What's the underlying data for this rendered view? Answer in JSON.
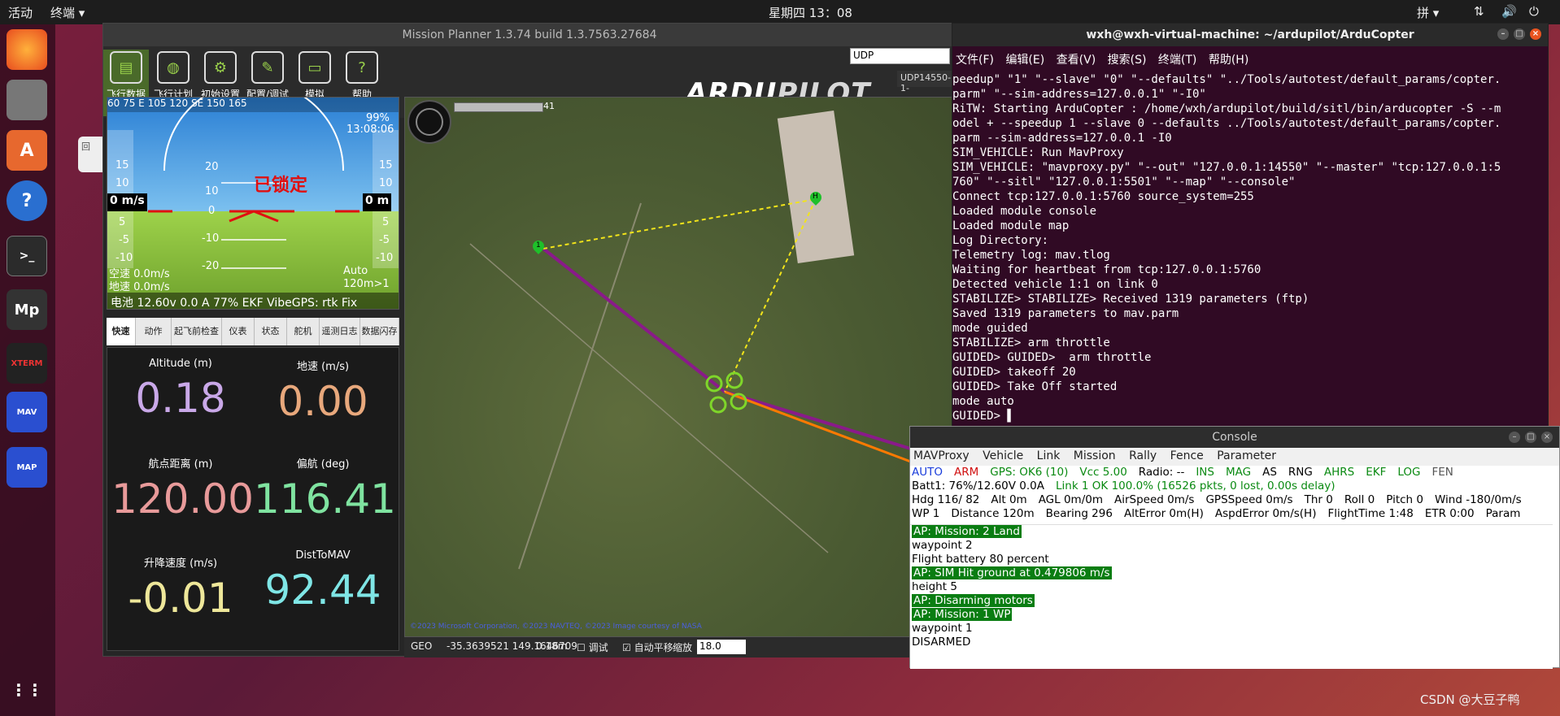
{
  "topbar": {
    "activities": "活动",
    "app": "终端 ▾",
    "clock": "星期四 13：08",
    "input": "拼 ▾"
  },
  "desktop": {
    "icon_label": "回"
  },
  "mp": {
    "title": "Mission Planner 1.3.74 build 1.3.7563.27684",
    "menu": [
      "飞行数据",
      "飞行计划",
      "初始设置",
      "配置/调试",
      "模拟",
      "帮助"
    ],
    "logo_main": "ARDU",
    "logo_sub": "PILOT",
    "conn_type": "UDP",
    "conn_port": "UDP14550-1-",
    "hud": {
      "heading_tape": "60   75   E   105  120  SE   150  165",
      "pct": "99%",
      "time": "13:08:06",
      "locked": "已锁定",
      "left_speed": "0 m/s",
      "right_alt": "0 m",
      "airspeed": "空速 0.0m/s",
      "groundspeed": "地速 0.0m/s",
      "mode": "Auto",
      "wp": "120m>1",
      "status_bar": "电池 12.60v 0.0 A 77% EKF VibeGPS: rtk Fix",
      "pitch_labels": [
        "20",
        "10",
        "0",
        "-10",
        "-20"
      ],
      "speed_ticks": [
        "15",
        "10",
        "5",
        "-5",
        "-10"
      ],
      "alt_ticks": [
        "15",
        "10",
        "5",
        "-5",
        "-10"
      ]
    },
    "tabs": [
      "快速",
      "动作",
      "起飞前检查",
      "仪表",
      "状态",
      "舵机",
      "遥测日志",
      "数据闪存"
    ],
    "quick": [
      {
        "label": "Altitude (m)",
        "value": "0.18",
        "color": "#c9a8e8"
      },
      {
        "label": "地速 (m/s)",
        "value": "0.00",
        "color": "#e8a87c"
      },
      {
        "label": "航点距离 (m)",
        "value": "120.00",
        "color": "#e89a9a"
      },
      {
        "label": "偏航 (deg)",
        "value": "116.41",
        "color": "#7fe3a0"
      },
      {
        "label": "升降速度 (m/s)",
        "value": "-0.01",
        "color": "#eee79a"
      },
      {
        "label": "DistToMAV",
        "value": "92.44",
        "color": "#7fe6e6"
      }
    ],
    "map": {
      "progress": "41",
      "copyright": "©2023 Microsoft Corporation, ©2023 NAVTEQ, ©2023 Image courtesy of NASA",
      "coord_sys": "GEO",
      "coords": "-35.3639521 149.1646709",
      "alt": "0.18m",
      "debug_label": "调试",
      "auto_pan_label": "自动平移",
      "zoom_label": "缩放",
      "zoom_value": "18.0",
      "home_label": "H",
      "wp_label": "1"
    }
  },
  "terminal": {
    "title": "wxh@wxh-virtual-machine: ~/ardupilot/ArduCopter",
    "menu": [
      "文件(F)",
      "编辑(E)",
      "查看(V)",
      "搜索(S)",
      "终端(T)",
      "帮助(H)"
    ],
    "lines": [
      "peedup\" \"1\" \"--slave\" \"0\" \"--defaults\" \"../Tools/autotest/default_params/copter.",
      "parm\" \"--sim-address=127.0.0.1\" \"-I0\"",
      "RiTW: Starting ArduCopter : /home/wxh/ardupilot/build/sitl/bin/arducopter -S --m",
      "odel + --speedup 1 --slave 0 --defaults ../Tools/autotest/default_params/copter.",
      "parm --sim-address=127.0.0.1 -I0",
      "SIM_VEHICLE: Run MavProxy",
      "SIM_VEHICLE: \"mavproxy.py\" \"--out\" \"127.0.0.1:14550\" \"--master\" \"tcp:127.0.0.1:5",
      "760\" \"--sitl\" \"127.0.0.1:5501\" \"--map\" \"--console\"",
      "Connect tcp:127.0.0.1:5760 source_system=255",
      "Loaded module console",
      "Loaded module map",
      "Log Directory:",
      "Telemetry log: mav.tlog",
      "Waiting for heartbeat from tcp:127.0.0.1:5760",
      "Detected vehicle 1:1 on link 0",
      "STABILIZE> STABILIZE> Received 1319 parameters (ftp)",
      "Saved 1319 parameters to mav.parm",
      "mode guided",
      "STABILIZE> arm throttle",
      "GUIDED> GUIDED>  arm throttle",
      "GUIDED> takeoff 20",
      "GUIDED> Take Off started",
      "mode auto",
      "GUIDED> ▌"
    ]
  },
  "console": {
    "title": "Console",
    "menu": [
      "MAVProxy",
      "Vehicle",
      "Link",
      "Mission",
      "Rally",
      "Fence",
      "Parameter"
    ],
    "status1": [
      {
        "t": "AUTO",
        "c": "#1a3ddb"
      },
      {
        "t": "ARM",
        "c": "#d01010"
      },
      {
        "t": "GPS: OK6 (10)",
        "c": "#0a8a12"
      },
      {
        "t": "Vcc 5.00",
        "c": "#0a8a12"
      },
      {
        "t": "Radio: --",
        "c": "#000"
      },
      {
        "t": "INS",
        "c": "#0a8a12"
      },
      {
        "t": "MAG",
        "c": "#0a8a12"
      },
      {
        "t": "AS",
        "c": "#000"
      },
      {
        "t": "RNG",
        "c": "#000"
      },
      {
        "t": "AHRS",
        "c": "#0a8a12"
      },
      {
        "t": "EKF",
        "c": "#0a8a12"
      },
      {
        "t": "LOG",
        "c": "#0a8a12"
      },
      {
        "t": "FEN",
        "c": "#555"
      }
    ],
    "status2": [
      {
        "t": "Batt1: 76%/12.60V 0.0A",
        "c": "#000"
      },
      {
        "t": "Link 1 OK 100.0% (16526 pkts, 0 lost, 0.00s delay)",
        "c": "#0a8a12"
      }
    ],
    "status3": [
      "Hdg 116/ 82",
      "Alt 0m",
      "AGL 0m/0m",
      "AirSpeed 0m/s",
      "GPSSpeed 0m/s",
      "Thr 0",
      "Roll 0",
      "Pitch 0",
      "Wind -180/0m/s"
    ],
    "status4": [
      "WP 1",
      "Distance 120m",
      "Bearing 296",
      "AltError 0m(H)",
      "AspdError 0m/s(H)",
      "FlightTime 1:48",
      "ETR 0:00",
      "Param"
    ],
    "messages": [
      {
        "t": "AP: Mission: 2 Land",
        "hl": true
      },
      {
        "t": "waypoint 2",
        "hl": false
      },
      {
        "t": "Flight battery 80 percent",
        "hl": false
      },
      {
        "t": "AP: SIM Hit ground at 0.479806 m/s",
        "hl": true
      },
      {
        "t": "height 5",
        "hl": false
      },
      {
        "t": "AP: Disarming motors",
        "hl": true
      },
      {
        "t": "AP: Mission: 1 WP",
        "hl": true
      },
      {
        "t": "waypoint 1",
        "hl": false
      },
      {
        "t": "DISARMED",
        "hl": false
      }
    ]
  },
  "watermark": "CSDN @大豆子鸭"
}
